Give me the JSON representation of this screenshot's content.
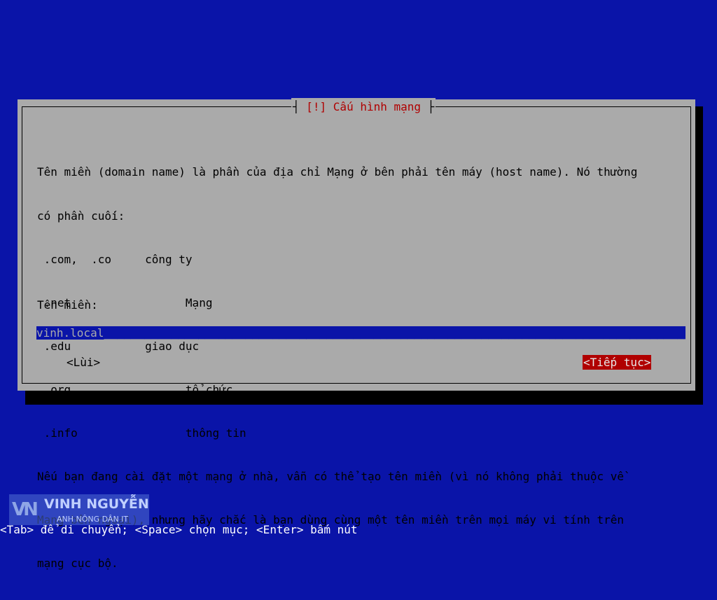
{
  "dialog": {
    "title": "[!] Cấu hình mạng",
    "description_lines": [
      "Tên miền (domain name) là phần của địa chỉ Mạng ở bên phải tên máy (host name). Nó thường",
      "có phần cuối:",
      " .com,  .co     công ty",
      " .net                 Mạng",
      " .edu           giao dục",
      " .org                 tổ chức.",
      " .info                thông tin",
      "Nếu bạn đang cài đặt một mạng ở nhà, vẫn có thể tạo tên miền (vì nó không phải thuộc về",
      "Mạng bên ngoại), nhưng hãy chắc là bạn dùng cùng một tên miền trên mọi máy vi tính trên",
      "mạng cục bộ."
    ],
    "field_label": "Tên miền:",
    "field_value": "vinh.local",
    "back_button": "<Lùi>",
    "continue_button": "<Tiếp tục>"
  },
  "help_bar": "<Tab> để di chuyển; <Space> chọn mục; <Enter> bấm nút",
  "watermark": {
    "name": "VINH NGUYỄN",
    "subtitle": "ANH NÔNG DÂN IT"
  },
  "colors": {
    "background": "#0a14a8",
    "dialog": "#aaaaaa",
    "accent": "#b00000"
  }
}
